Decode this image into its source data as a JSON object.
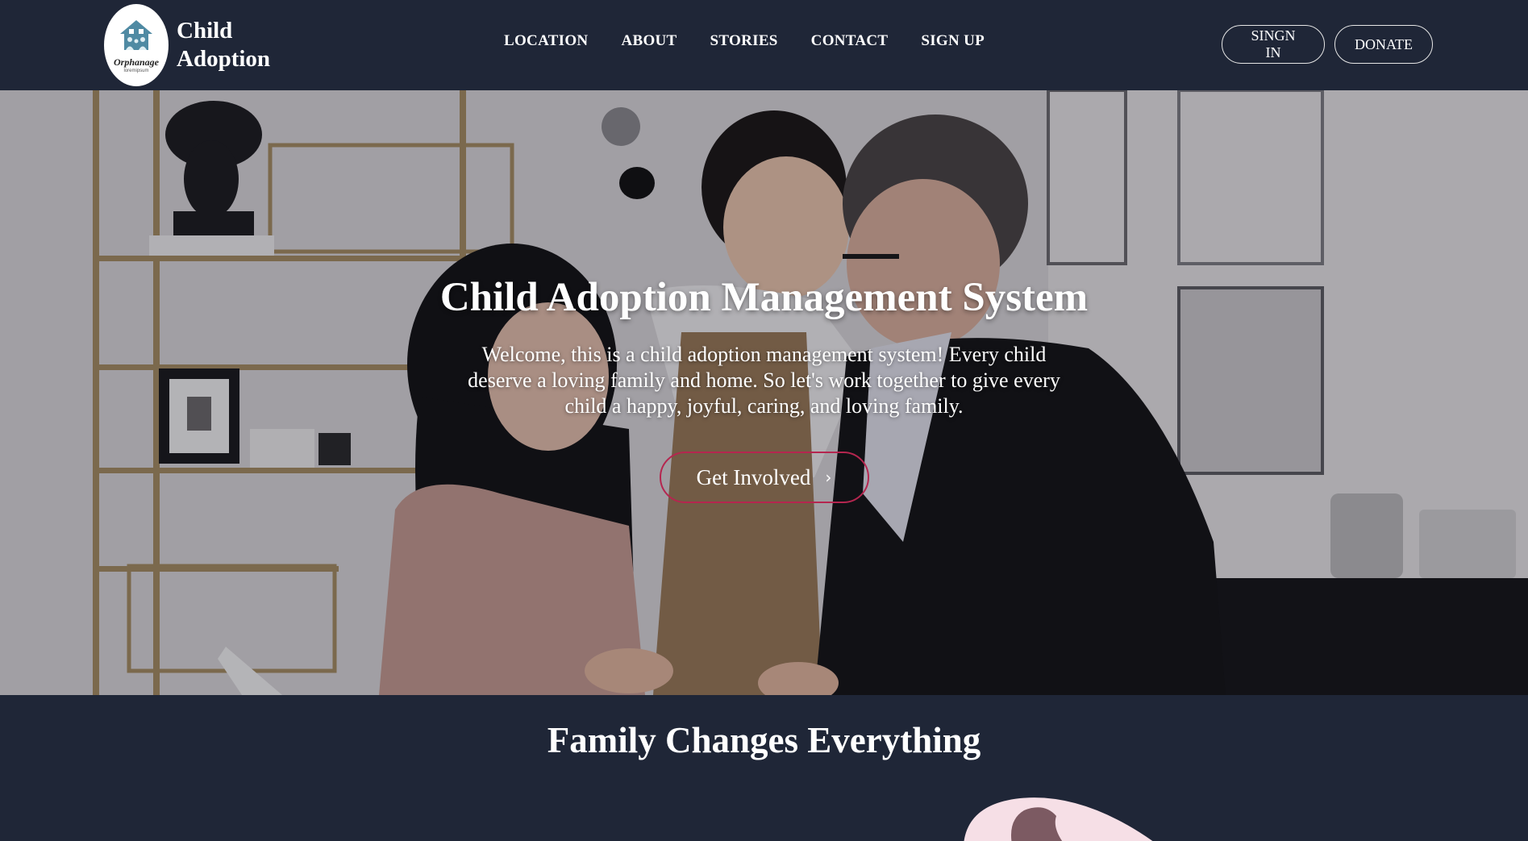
{
  "header": {
    "logo": {
      "word": "Orphanage",
      "subtext": "loremipsum"
    },
    "brand_line1": "Child",
    "brand_line2": "Adoption",
    "nav": [
      {
        "label": "LOCATION"
      },
      {
        "label": "ABOUT"
      },
      {
        "label": "STORIES"
      },
      {
        "label": "CONTACT"
      },
      {
        "label": "SIGN UP"
      }
    ],
    "signin_label": "SINGN IN",
    "donate_label": "DONATE"
  },
  "hero": {
    "title": "Child Adoption Management System",
    "text": "Welcome, this is a child adoption management system! Every child deserve a loving family and home. So let's work together to give every child a happy, joyful, caring, and loving family.",
    "cta_label": "Get Involved",
    "cta_icon": "chevron-right-icon",
    "image_description_icon": "family-photo"
  },
  "section": {
    "title": "Family Changes Everything"
  },
  "colors": {
    "header_bg": "#1f2637",
    "accent": "#b5264f",
    "blob": "#f6dfe6"
  }
}
